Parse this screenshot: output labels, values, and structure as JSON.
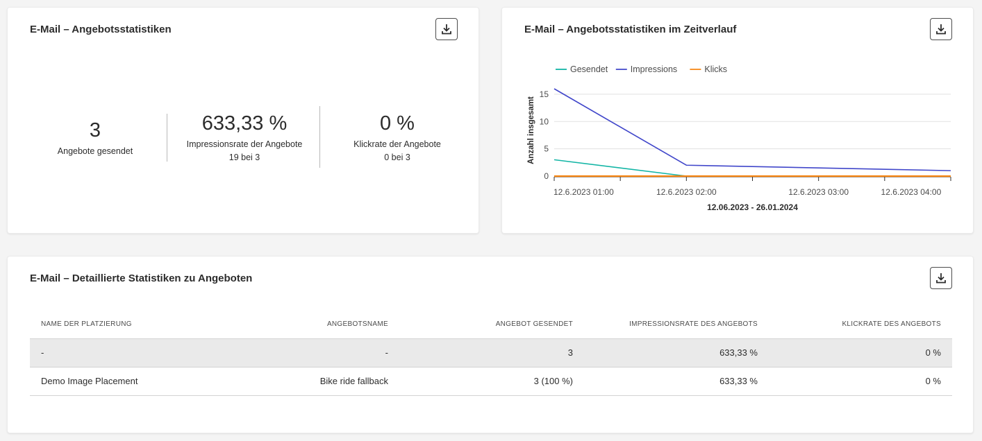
{
  "stats_card": {
    "title": "E-Mail – Angebotsstatistiken",
    "metrics": [
      {
        "value": "3",
        "label": "Angebote gesendet",
        "sub": ""
      },
      {
        "value": "633,33 %",
        "label": "Impressionsrate der Angebote",
        "sub": "19 bei 3"
      },
      {
        "value": "0 %",
        "label": "Klickrate der Angebote",
        "sub": "0 bei 3"
      }
    ]
  },
  "trend_card": {
    "title": "E-Mail – Angebotsstatistiken im Zeitverlauf"
  },
  "chart_data": {
    "type": "line",
    "ylabel": "Anzahl insgesamt",
    "xlabel": "12.06.2023 - 26.01.2024",
    "ylim": [
      0,
      16
    ],
    "yticks": [
      0,
      5,
      10,
      15
    ],
    "x_tick_labels": [
      {
        "label": "12.6.2023 01:00",
        "t": 0
      },
      {
        "label": "12.6.2023 02:00",
        "t": 1
      },
      {
        "label": "12.6.2023 03:00",
        "t": 2.0
      },
      {
        "label": "12.6.2023 04:00",
        "t": 2.7
      }
    ],
    "legend": "top-left",
    "grid": true,
    "series": [
      {
        "name": "Gesendet",
        "color": "#12b5a5",
        "points": [
          [
            0,
            3
          ],
          [
            1,
            0
          ],
          [
            3,
            0
          ]
        ]
      },
      {
        "name": "Impressions",
        "color": "#4046ca",
        "points": [
          [
            0,
            16
          ],
          [
            1,
            2
          ],
          [
            3,
            1
          ]
        ]
      },
      {
        "name": "Klicks",
        "color": "#f68511",
        "points": [
          [
            0,
            0
          ],
          [
            1,
            0
          ],
          [
            3,
            0
          ]
        ]
      }
    ]
  },
  "table_card": {
    "title": "E-Mail – Detaillierte Statistiken zu Angeboten",
    "columns": [
      "NAME DER PLATZIERUNG",
      "ANGEBOTSNAME",
      "ANGEBOT GESENDET",
      "IMPRESSIONSRATE DES ANGEBOTS",
      "KLICKRATE DES ANGEBOTS"
    ],
    "rows": [
      [
        "-",
        "-",
        "3",
        "633,33 %",
        "0 %"
      ],
      [
        "Demo Image Placement",
        "Bike ride fallback",
        "3 (100 %)",
        "633,33 %",
        "0 %"
      ]
    ]
  },
  "icons": {
    "download": "download-icon"
  }
}
